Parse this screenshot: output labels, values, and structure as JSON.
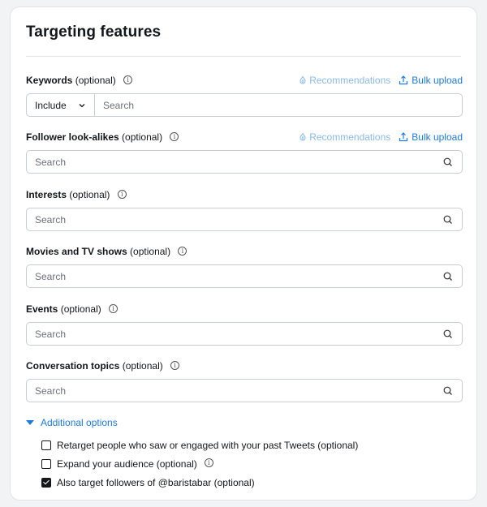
{
  "card": {
    "title": "Targeting features"
  },
  "keywords": {
    "label": "Keywords",
    "optional": "(optional)",
    "recommendations": "Recommendations",
    "bulk_upload": "Bulk upload",
    "select_value": "Include",
    "placeholder": "Search"
  },
  "follower_lookalikes": {
    "label": "Follower look-alikes",
    "optional": "(optional)",
    "recommendations": "Recommendations",
    "bulk_upload": "Bulk upload",
    "placeholder": "Search"
  },
  "interests": {
    "label": "Interests",
    "optional": "(optional)",
    "placeholder": "Search"
  },
  "movies_tv": {
    "label": "Movies and TV shows",
    "optional": "(optional)",
    "placeholder": "Search"
  },
  "events": {
    "label": "Events",
    "optional": "(optional)",
    "placeholder": "Search"
  },
  "conversation_topics": {
    "label": "Conversation topics",
    "optional": "(optional)",
    "placeholder": "Search"
  },
  "additional_options": {
    "label": "Additional options",
    "items": [
      {
        "label": "Retarget people who saw or engaged with your past Tweets (optional)",
        "checked": false
      },
      {
        "label": "Expand your audience (optional)",
        "checked": false
      },
      {
        "label": "Also target followers of @baristabar (optional)",
        "checked": true
      }
    ]
  },
  "icons": {
    "info": "info-icon",
    "search": "search-icon",
    "recommendations": "recommendations-icon",
    "upload": "upload-icon",
    "chevron": "chevron-down-icon"
  },
  "colors": {
    "accent": "#1d7ae0",
    "accent_light": "#8bb9e6",
    "border": "#c9ced4",
    "text": "#14171a"
  }
}
